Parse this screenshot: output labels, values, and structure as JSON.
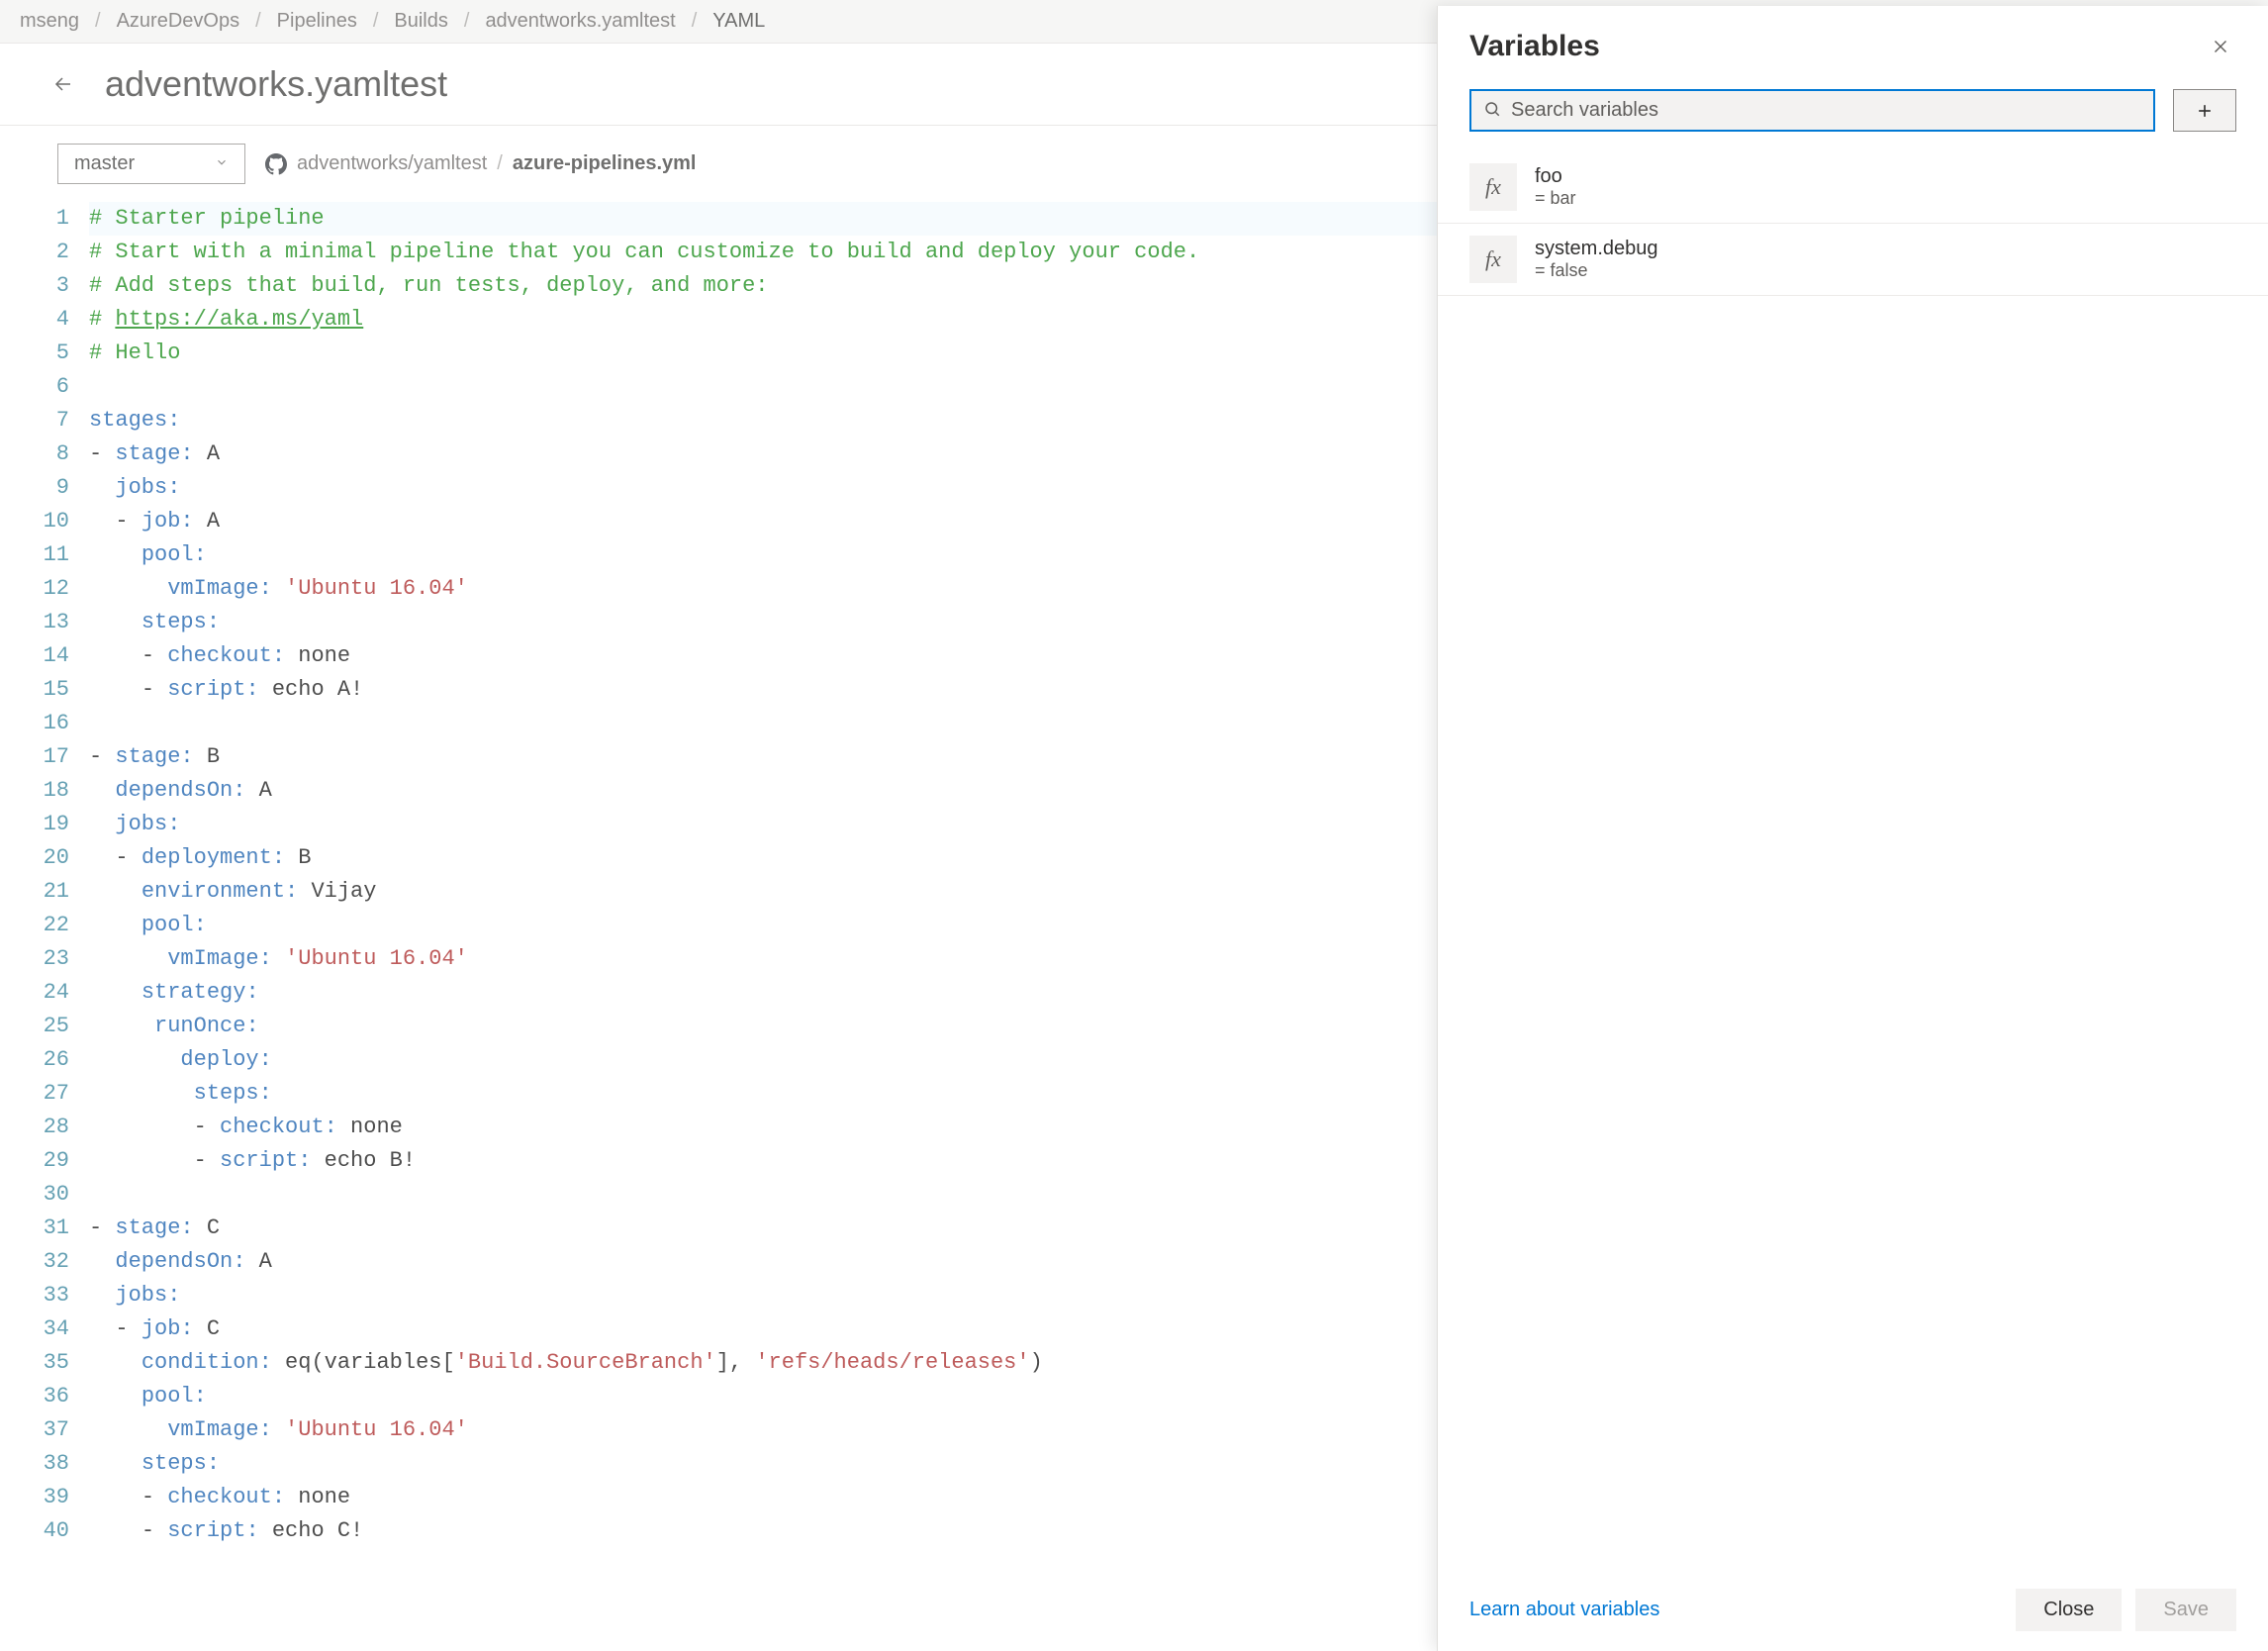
{
  "breadcrumb": [
    "mseng",
    "AzureDevOps",
    "Pipelines",
    "Builds",
    "adventworks.yamltest",
    "YAML"
  ],
  "pageTitle": "adventworks.yamltest",
  "branch": "master",
  "repo": "adventworks/yamltest",
  "file": "azure-pipelines.yml",
  "code": [
    {
      "n": 1,
      "hl": true,
      "tokens": [
        {
          "t": "# Starter pipeline",
          "c": "comment"
        }
      ]
    },
    {
      "n": 2,
      "tokens": [
        {
          "t": "# Start with a minimal pipeline that you can customize to build and deploy your code.",
          "c": "comment"
        }
      ]
    },
    {
      "n": 3,
      "tokens": [
        {
          "t": "# Add steps that build, run tests, deploy, and more:",
          "c": "comment"
        }
      ]
    },
    {
      "n": 4,
      "tokens": [
        {
          "t": "# ",
          "c": "comment"
        },
        {
          "t": "https://aka.ms/yaml",
          "c": "link"
        }
      ]
    },
    {
      "n": 5,
      "tokens": [
        {
          "t": "# Hello",
          "c": "comment"
        }
      ]
    },
    {
      "n": 6,
      "tokens": []
    },
    {
      "n": 7,
      "tokens": [
        {
          "t": "stages",
          "c": "key"
        },
        {
          "t": ":",
          "c": "colon"
        }
      ]
    },
    {
      "n": 8,
      "tokens": [
        {
          "t": "- ",
          "c": "dash"
        },
        {
          "t": "stage",
          "c": "key"
        },
        {
          "t": ":",
          "c": "colon"
        },
        {
          "t": " A",
          "c": "ident"
        }
      ]
    },
    {
      "n": 9,
      "tokens": [
        {
          "t": "  ",
          "c": "guide"
        },
        {
          "t": "jobs",
          "c": "key"
        },
        {
          "t": ":",
          "c": "colon"
        }
      ]
    },
    {
      "n": 10,
      "tokens": [
        {
          "t": "  ",
          "c": "guide"
        },
        {
          "t": "- ",
          "c": "dash"
        },
        {
          "t": "job",
          "c": "key"
        },
        {
          "t": ":",
          "c": "colon"
        },
        {
          "t": " A",
          "c": "ident"
        }
      ]
    },
    {
      "n": 11,
      "tokens": [
        {
          "t": "    ",
          "c": "guide"
        },
        {
          "t": "pool",
          "c": "key"
        },
        {
          "t": ":",
          "c": "colon"
        }
      ]
    },
    {
      "n": 12,
      "tokens": [
        {
          "t": "      ",
          "c": "guide"
        },
        {
          "t": "vmImage",
          "c": "key"
        },
        {
          "t": ":",
          "c": "colon"
        },
        {
          "t": " ",
          "c": "ident"
        },
        {
          "t": "'Ubuntu 16.04'",
          "c": "string"
        }
      ]
    },
    {
      "n": 13,
      "tokens": [
        {
          "t": "    ",
          "c": "guide"
        },
        {
          "t": "steps",
          "c": "key"
        },
        {
          "t": ":",
          "c": "colon"
        }
      ]
    },
    {
      "n": 14,
      "tokens": [
        {
          "t": "    ",
          "c": "guide"
        },
        {
          "t": "- ",
          "c": "dash"
        },
        {
          "t": "checkout",
          "c": "key"
        },
        {
          "t": ":",
          "c": "colon"
        },
        {
          "t": " none",
          "c": "ident"
        }
      ]
    },
    {
      "n": 15,
      "tokens": [
        {
          "t": "    ",
          "c": "guide"
        },
        {
          "t": "- ",
          "c": "dash"
        },
        {
          "t": "script",
          "c": "key"
        },
        {
          "t": ":",
          "c": "colon"
        },
        {
          "t": " echo A!",
          "c": "ident"
        }
      ]
    },
    {
      "n": 16,
      "tokens": []
    },
    {
      "n": 17,
      "tokens": [
        {
          "t": "- ",
          "c": "dash"
        },
        {
          "t": "stage",
          "c": "key"
        },
        {
          "t": ":",
          "c": "colon"
        },
        {
          "t": " B",
          "c": "ident"
        }
      ]
    },
    {
      "n": 18,
      "tokens": [
        {
          "t": "  ",
          "c": "guide"
        },
        {
          "t": "dependsOn",
          "c": "key"
        },
        {
          "t": ":",
          "c": "colon"
        },
        {
          "t": " A",
          "c": "ident"
        }
      ]
    },
    {
      "n": 19,
      "tokens": [
        {
          "t": "  ",
          "c": "guide"
        },
        {
          "t": "jobs",
          "c": "key"
        },
        {
          "t": ":",
          "c": "colon"
        }
      ]
    },
    {
      "n": 20,
      "tokens": [
        {
          "t": "  ",
          "c": "guide"
        },
        {
          "t": "- ",
          "c": "dash"
        },
        {
          "t": "deployment",
          "c": "key"
        },
        {
          "t": ":",
          "c": "colon"
        },
        {
          "t": " B",
          "c": "ident"
        }
      ]
    },
    {
      "n": 21,
      "tokens": [
        {
          "t": "    ",
          "c": "guide"
        },
        {
          "t": "environment",
          "c": "key"
        },
        {
          "t": ":",
          "c": "colon"
        },
        {
          "t": " Vijay",
          "c": "ident"
        }
      ]
    },
    {
      "n": 22,
      "tokens": [
        {
          "t": "    ",
          "c": "guide"
        },
        {
          "t": "pool",
          "c": "key"
        },
        {
          "t": ":",
          "c": "colon"
        }
      ]
    },
    {
      "n": 23,
      "tokens": [
        {
          "t": "      ",
          "c": "guide"
        },
        {
          "t": "vmImage",
          "c": "key"
        },
        {
          "t": ":",
          "c": "colon"
        },
        {
          "t": " ",
          "c": "ident"
        },
        {
          "t": "'Ubuntu 16.04'",
          "c": "string"
        }
      ]
    },
    {
      "n": 24,
      "tokens": [
        {
          "t": "    ",
          "c": "guide"
        },
        {
          "t": "strategy",
          "c": "key"
        },
        {
          "t": ":",
          "c": "colon"
        }
      ]
    },
    {
      "n": 25,
      "tokens": [
        {
          "t": "     ",
          "c": "guide"
        },
        {
          "t": "runOnce",
          "c": "key"
        },
        {
          "t": ":",
          "c": "colon"
        }
      ]
    },
    {
      "n": 26,
      "tokens": [
        {
          "t": "       ",
          "c": "guide"
        },
        {
          "t": "deploy",
          "c": "key"
        },
        {
          "t": ":",
          "c": "colon"
        }
      ]
    },
    {
      "n": 27,
      "tokens": [
        {
          "t": "        ",
          "c": "guide"
        },
        {
          "t": "steps",
          "c": "key"
        },
        {
          "t": ":",
          "c": "colon"
        }
      ]
    },
    {
      "n": 28,
      "tokens": [
        {
          "t": "        ",
          "c": "guide"
        },
        {
          "t": "- ",
          "c": "dash"
        },
        {
          "t": "checkout",
          "c": "key"
        },
        {
          "t": ":",
          "c": "colon"
        },
        {
          "t": " none",
          "c": "ident"
        }
      ]
    },
    {
      "n": 29,
      "tokens": [
        {
          "t": "        ",
          "c": "guide"
        },
        {
          "t": "- ",
          "c": "dash"
        },
        {
          "t": "script",
          "c": "key"
        },
        {
          "t": ":",
          "c": "colon"
        },
        {
          "t": " echo B!",
          "c": "ident"
        }
      ]
    },
    {
      "n": 30,
      "tokens": []
    },
    {
      "n": 31,
      "tokens": [
        {
          "t": "- ",
          "c": "dash"
        },
        {
          "t": "stage",
          "c": "key"
        },
        {
          "t": ":",
          "c": "colon"
        },
        {
          "t": " C",
          "c": "ident"
        }
      ]
    },
    {
      "n": 32,
      "tokens": [
        {
          "t": "  ",
          "c": "guide"
        },
        {
          "t": "dependsOn",
          "c": "key"
        },
        {
          "t": ":",
          "c": "colon"
        },
        {
          "t": " A",
          "c": "ident"
        }
      ]
    },
    {
      "n": 33,
      "tokens": [
        {
          "t": "  ",
          "c": "guide"
        },
        {
          "t": "jobs",
          "c": "key"
        },
        {
          "t": ":",
          "c": "colon"
        }
      ]
    },
    {
      "n": 34,
      "tokens": [
        {
          "t": "  ",
          "c": "guide"
        },
        {
          "t": "- ",
          "c": "dash"
        },
        {
          "t": "job",
          "c": "key"
        },
        {
          "t": ":",
          "c": "colon"
        },
        {
          "t": " C",
          "c": "ident"
        }
      ]
    },
    {
      "n": 35,
      "tokens": [
        {
          "t": "    ",
          "c": "guide"
        },
        {
          "t": "condition",
          "c": "key"
        },
        {
          "t": ":",
          "c": "colon"
        },
        {
          "t": " eq(variables[",
          "c": "ident"
        },
        {
          "t": "'Build.SourceBranch'",
          "c": "string"
        },
        {
          "t": "], ",
          "c": "ident"
        },
        {
          "t": "'refs/heads/releases'",
          "c": "string"
        },
        {
          "t": ")",
          "c": "ident"
        }
      ]
    },
    {
      "n": 36,
      "tokens": [
        {
          "t": "    ",
          "c": "guide"
        },
        {
          "t": "pool",
          "c": "key"
        },
        {
          "t": ":",
          "c": "colon"
        }
      ]
    },
    {
      "n": 37,
      "tokens": [
        {
          "t": "      ",
          "c": "guide"
        },
        {
          "t": "vmImage",
          "c": "key"
        },
        {
          "t": ":",
          "c": "colon"
        },
        {
          "t": " ",
          "c": "ident"
        },
        {
          "t": "'Ubuntu 16.04'",
          "c": "string"
        }
      ]
    },
    {
      "n": 38,
      "tokens": [
        {
          "t": "    ",
          "c": "guide"
        },
        {
          "t": "steps",
          "c": "key"
        },
        {
          "t": ":",
          "c": "colon"
        }
      ]
    },
    {
      "n": 39,
      "tokens": [
        {
          "t": "    ",
          "c": "guide"
        },
        {
          "t": "- ",
          "c": "dash"
        },
        {
          "t": "checkout",
          "c": "key"
        },
        {
          "t": ":",
          "c": "colon"
        },
        {
          "t": " none",
          "c": "ident"
        }
      ]
    },
    {
      "n": 40,
      "tokens": [
        {
          "t": "    ",
          "c": "guide"
        },
        {
          "t": "- ",
          "c": "dash"
        },
        {
          "t": "script",
          "c": "key"
        },
        {
          "t": ":",
          "c": "colon"
        },
        {
          "t": " echo C!",
          "c": "ident"
        }
      ]
    }
  ],
  "panel": {
    "title": "Variables",
    "searchPlaceholder": "Search variables",
    "variables": [
      {
        "name": "foo",
        "value": "= bar"
      },
      {
        "name": "system.debug",
        "value": "= false"
      }
    ],
    "learnLabel": "Learn about variables",
    "closeLabel": "Close",
    "saveLabel": "Save"
  }
}
